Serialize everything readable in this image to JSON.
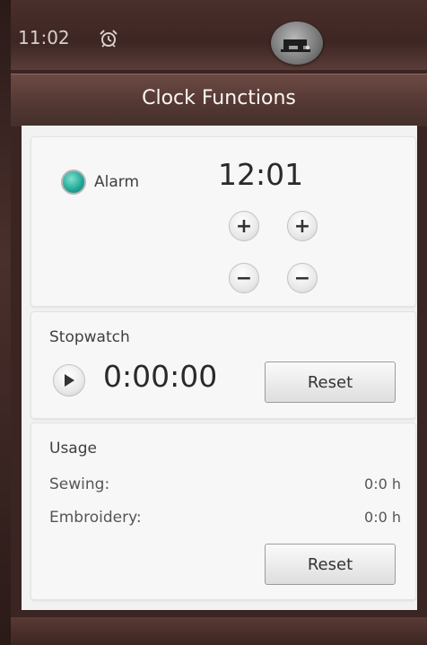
{
  "status_bar": {
    "time": "11:02"
  },
  "dialog": {
    "title": "Clock Functions"
  },
  "alarm": {
    "label": "Alarm",
    "time": "12:01"
  },
  "stopwatch": {
    "section_label": "Stopwatch",
    "time": "0:00:00",
    "reset_label": "Reset"
  },
  "usage": {
    "section_label": "Usage",
    "sewing_label": "Sewing:",
    "sewing_value": "0:0 h",
    "embroidery_label": "Embroidery:",
    "embroidery_value": "0:0 h",
    "reset_label": "Reset"
  },
  "icons": {
    "alarm_status": "alarm-clock-icon",
    "machine": "sewing-machine-icon",
    "increment": "plus-icon",
    "decrement": "minus-icon",
    "start": "play-icon"
  },
  "colors": {
    "accent": "#1fa594",
    "header": "#543833"
  }
}
